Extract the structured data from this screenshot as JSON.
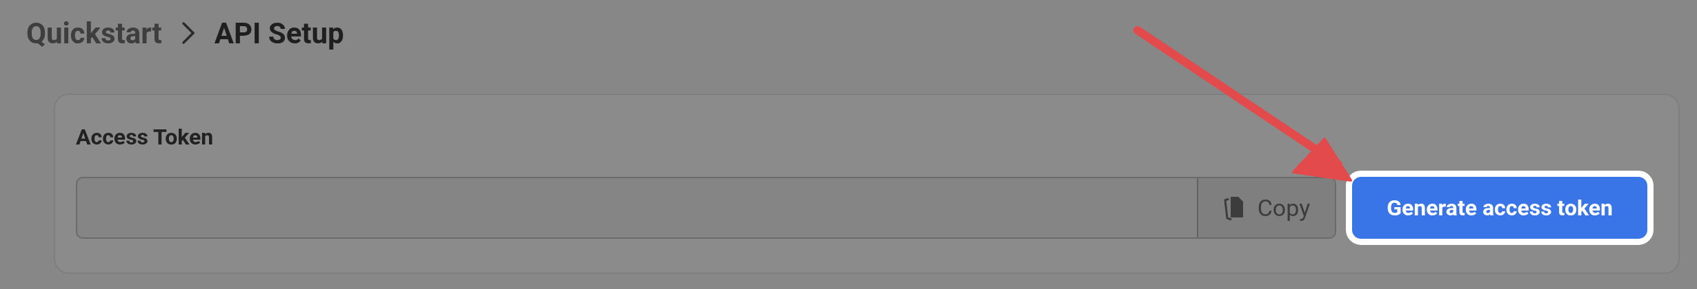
{
  "breadcrumb": [
    {
      "label": "Quickstart",
      "current": false
    },
    {
      "label": "API Setup",
      "current": true
    }
  ],
  "card": {
    "title": "Access Token",
    "copy_button": "Copy",
    "generate_button": "Generate access token"
  }
}
